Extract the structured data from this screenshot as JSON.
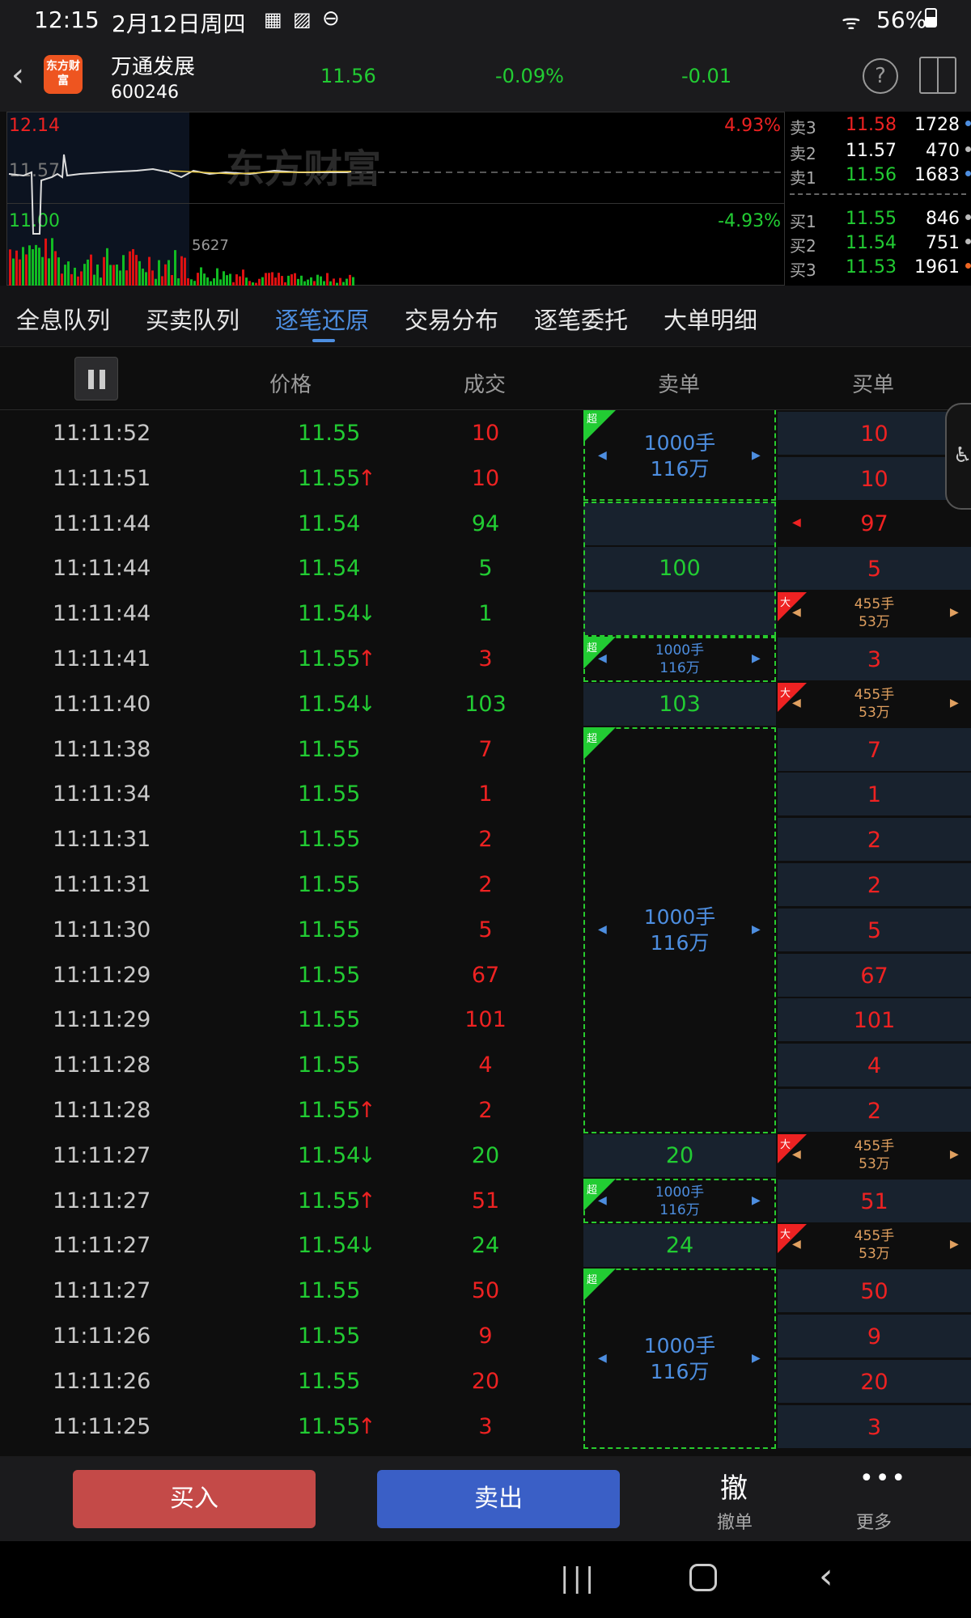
{
  "status": {
    "time": "12:15",
    "date": "2月12日周四",
    "battery": "56%"
  },
  "stock": {
    "logo": "东方财富",
    "name": "万通发展",
    "code": "600246",
    "price": "11.56",
    "pct": "-0.09%",
    "change": "-0.01"
  },
  "chart": {
    "high": "12.14",
    "mid": "11.57",
    "low": "11.00",
    "pct_up": "4.93%",
    "pct_down": "-4.93%",
    "vol": "5627",
    "watermark": "东方财富"
  },
  "orderbook": [
    {
      "label": "卖3",
      "price": "11.58",
      "vol": "1728"
    },
    {
      "label": "卖2",
      "price": "11.57",
      "vol": "470"
    },
    {
      "label": "卖1",
      "price": "11.56",
      "vol": "1683"
    },
    {
      "label": "买1",
      "price": "11.55",
      "vol": "846"
    },
    {
      "label": "买2",
      "price": "11.54",
      "vol": "751"
    },
    {
      "label": "买3",
      "price": "11.53",
      "vol": "1961"
    }
  ],
  "tabs": [
    "全息队列",
    "买卖队列",
    "逐笔还原",
    "交易分布",
    "逐笔委托",
    "大单明细"
  ],
  "columns": {
    "price": "价格",
    "deal": "成交",
    "sell": "卖单",
    "buy": "买单"
  },
  "rows": [
    {
      "time": "11:11:52",
      "price": "11.55",
      "arrow": "",
      "vol": "10",
      "buy": "10"
    },
    {
      "time": "11:11:51",
      "price": "11.55",
      "arrow": "↑",
      "vol": "10",
      "buy": "10"
    },
    {
      "time": "11:11:44",
      "price": "11.54",
      "arrow": "",
      "vol": "94",
      "buy": "97"
    },
    {
      "time": "11:11:44",
      "price": "11.54",
      "arrow": "",
      "vol": "5",
      "buy": "5"
    },
    {
      "time": "11:11:44",
      "price": "11.54",
      "arrow": "↓",
      "vol": "1",
      "buy": ""
    },
    {
      "time": "11:11:41",
      "price": "11.55",
      "arrow": "↑",
      "vol": "3",
      "buy": "3"
    },
    {
      "time": "11:11:40",
      "price": "11.54",
      "arrow": "↓",
      "vol": "103",
      "buy": ""
    },
    {
      "time": "11:11:38",
      "price": "11.55",
      "arrow": "",
      "vol": "7",
      "buy": "7"
    },
    {
      "time": "11:11:34",
      "price": "11.55",
      "arrow": "",
      "vol": "1",
      "buy": "1"
    },
    {
      "time": "11:11:31",
      "price": "11.55",
      "arrow": "",
      "vol": "2",
      "buy": "2"
    },
    {
      "time": "11:11:31",
      "price": "11.55",
      "arrow": "",
      "vol": "2",
      "buy": "2"
    },
    {
      "time": "11:11:30",
      "price": "11.55",
      "arrow": "",
      "vol": "5",
      "buy": "5"
    },
    {
      "time": "11:11:29",
      "price": "11.55",
      "arrow": "",
      "vol": "67",
      "buy": "67"
    },
    {
      "time": "11:11:29",
      "price": "11.55",
      "arrow": "",
      "vol": "101",
      "buy": "101"
    },
    {
      "time": "11:11:28",
      "price": "11.55",
      "arrow": "",
      "vol": "4",
      "buy": "4"
    },
    {
      "time": "11:11:28",
      "price": "11.55",
      "arrow": "↑",
      "vol": "2",
      "buy": "2"
    },
    {
      "time": "11:11:27",
      "price": "11.54",
      "arrow": "↓",
      "vol": "20",
      "buy": ""
    },
    {
      "time": "11:11:27",
      "price": "11.55",
      "arrow": "↑",
      "vol": "51",
      "buy": "51"
    },
    {
      "time": "11:11:27",
      "price": "11.54",
      "arrow": "↓",
      "vol": "24",
      "buy": ""
    },
    {
      "time": "11:11:27",
      "price": "11.55",
      "arrow": "",
      "vol": "50",
      "buy": "50"
    },
    {
      "time": "11:11:26",
      "price": "11.55",
      "arrow": "",
      "vol": "9",
      "buy": "9"
    },
    {
      "time": "11:11:26",
      "price": "11.55",
      "arrow": "",
      "vol": "20",
      "buy": "20"
    },
    {
      "time": "11:11:25",
      "price": "11.55",
      "arrow": "↑",
      "vol": "3",
      "buy": "3"
    }
  ],
  "sell_cells": {
    "r3": "100",
    "r6": "103",
    "r16": "20",
    "r18": "24"
  },
  "big_orders": {
    "super_tag": "超",
    "large_tag": "大",
    "super_qty": "1000手",
    "super_amt": "116万",
    "large_qty": "455手",
    "large_amt": "53万"
  },
  "bottom": {
    "buy": "买入",
    "sell": "卖出",
    "cancel_icon": "撤",
    "cancel": "撤单",
    "more": "更多"
  }
}
